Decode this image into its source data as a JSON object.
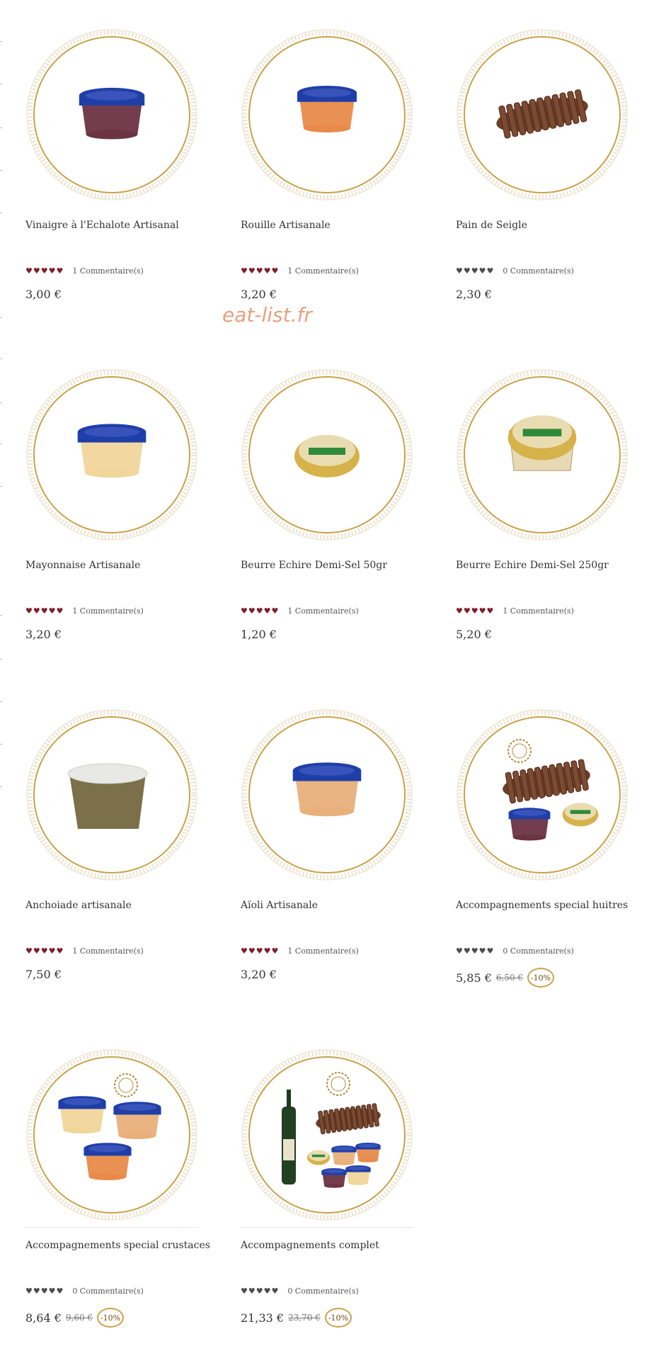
{
  "watermark": "eat-list.fr",
  "colors": {
    "heart_on": "#7d1f2a",
    "heart_off": "#4d4d4d",
    "ring": "#c8a24a",
    "discount_ring": "#c8a24a"
  },
  "products": [
    {
      "name": "Vinaigre à l'Echalote Artisanal",
      "hearts": "♥♥♥♥♥",
      "rated": true,
      "comments": "1 Commentaire(s)",
      "price": "3,00 €",
      "old_price": "",
      "discount": "",
      "image": "shallot-vinegar-tub"
    },
    {
      "name": "Rouille Artisanale",
      "hearts": "♥♥♥♥♥",
      "rated": true,
      "comments": "1 Commentaire(s)",
      "price": "3,20 €",
      "old_price": "",
      "discount": "",
      "image": "rouille-tub"
    },
    {
      "name": "Pain de Seigle",
      "hearts": "♥♥♥♥♥",
      "rated": false,
      "comments": "0 Commentaire(s)",
      "price": "2,30 €",
      "old_price": "",
      "discount": "",
      "image": "rye-bread"
    },
    {
      "name": "Mayonnaise Artisanale",
      "hearts": "♥♥♥♥♥",
      "rated": true,
      "comments": "1 Commentaire(s)",
      "price": "3,20 €",
      "old_price": "",
      "discount": "",
      "image": "mayonnaise-tub"
    },
    {
      "name": "Beurre Echire Demi-Sel 50gr",
      "hearts": "♥♥♥♥♥",
      "rated": true,
      "comments": "1 Commentaire(s)",
      "price": "1,20 €",
      "old_price": "",
      "discount": "",
      "image": "echire-butter-small"
    },
    {
      "name": "Beurre Echire Demi-Sel 250gr",
      "hearts": "♥♥♥♥♥",
      "rated": true,
      "comments": "1 Commentaire(s)",
      "price": "5,20 €",
      "old_price": "",
      "discount": "",
      "image": "echire-butter-basket"
    },
    {
      "name": "Anchoiade artisanale",
      "hearts": "♥♥♥♥♥",
      "rated": true,
      "comments": "1 Commentaire(s)",
      "price": "7,50 €",
      "old_price": "",
      "discount": "",
      "image": "anchoiade-tub"
    },
    {
      "name": "Aïoli Artisanale",
      "hearts": "♥♥♥♥♥",
      "rated": true,
      "comments": "1 Commentaire(s)",
      "price": "3,20 €",
      "old_price": "",
      "discount": "",
      "image": "aioli-tub"
    },
    {
      "name": "Accompagnements special huitres",
      "hearts": "♥♥♥♥♥",
      "rated": false,
      "comments": "0 Commentaire(s)",
      "price": "5,85 €",
      "old_price": "6,50 €",
      "discount": "-10%",
      "image": "oyster-bundle"
    },
    {
      "name": "Accompagnements special crustaces",
      "hearts": "♥♥♥♥♥",
      "rated": false,
      "comments": "0 Commentaire(s)",
      "price": "8,64 €",
      "old_price": "9,60 €",
      "discount": "-10%",
      "image": "crustacean-bundle"
    },
    {
      "name": "Accompagnements complet",
      "hearts": "♥♥♥♥♥",
      "rated": false,
      "comments": "0 Commentaire(s)",
      "price": "21,33 €",
      "old_price": "23,70 €",
      "discount": "-10%",
      "image": "complete-bundle"
    }
  ]
}
